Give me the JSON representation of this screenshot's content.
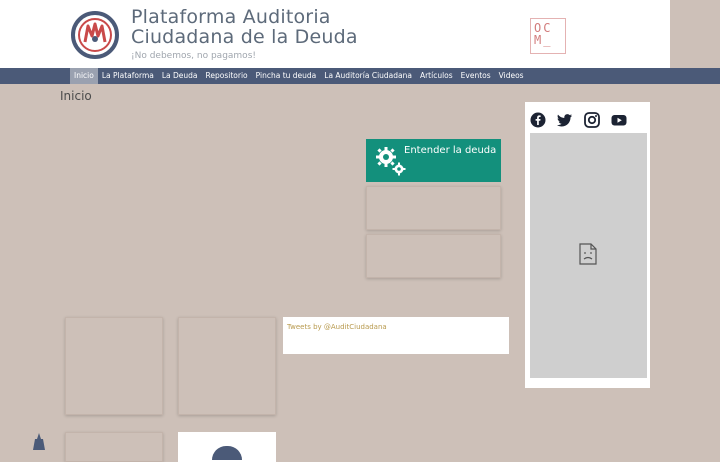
{
  "header": {
    "title_line1": "Plataforma Auditoria",
    "title_line2": "Ciudadana de la Deuda",
    "tagline": "¡No debemos, no pagamos!",
    "partner_logo_text": "OC\nM_"
  },
  "nav": {
    "items": [
      {
        "label": "Inicio"
      },
      {
        "label": "La Plataforma"
      },
      {
        "label": "La Deuda"
      },
      {
        "label": "Repositorio"
      },
      {
        "label": "Pincha tu deuda"
      },
      {
        "label": "La Auditoría Ciudadana"
      },
      {
        "label": "Artículos"
      },
      {
        "label": "Eventos"
      },
      {
        "label": "Videos"
      }
    ],
    "active_index": 0
  },
  "breadcrumb": "Inicio",
  "feature": {
    "label": "Entender la deuda",
    "icon": "gears-icon"
  },
  "social": {
    "icons": [
      "facebook-icon",
      "twitter-icon",
      "instagram-icon",
      "youtube-icon"
    ]
  },
  "tweets": {
    "link_text": "Tweets by @AuditCiudadana"
  },
  "colors": {
    "nav_bg": "#4b5a78",
    "accent_green": "#13907c",
    "page_bg": "#cdc0b8",
    "link": "#b89a4e"
  }
}
